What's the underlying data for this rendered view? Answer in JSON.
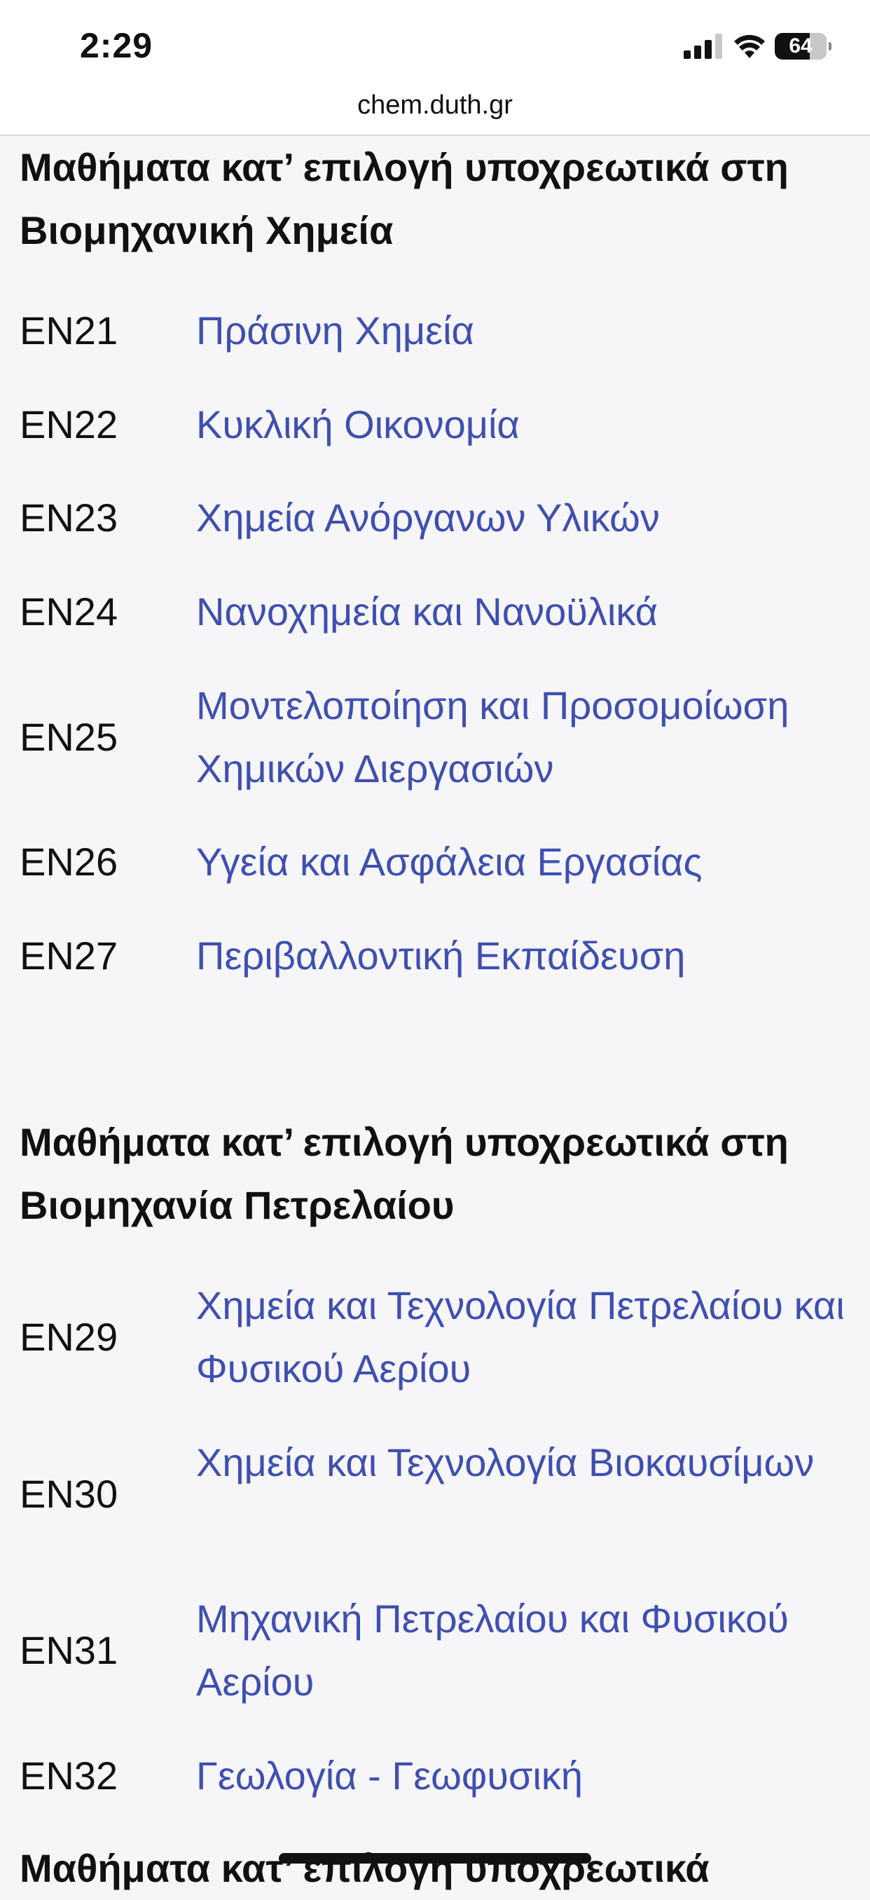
{
  "status_bar": {
    "time": "2:29",
    "battery": "64"
  },
  "browser": {
    "url": "chem.duth.gr"
  },
  "sections": [
    {
      "title": "Μαθήματα κατ’ επιλογή υποχρεωτικά στη Βιομηχανική Χημεία",
      "courses": [
        {
          "code": "EN21",
          "name": "Πράσινη Χημεία"
        },
        {
          "code": "EN22",
          "name": "Κυκλική Οικονομία"
        },
        {
          "code": "EN23",
          "name": "Χημεία Ανόργανων Υλικών"
        },
        {
          "code": "EN24",
          "name": "Νανοχημεία και Νανοϋλικά"
        },
        {
          "code": "EN25",
          "name": "Μοντελοποίηση και Προσομοίωση Χημικών Διεργασιών"
        },
        {
          "code": "EN26",
          "name": "Υγεία και Ασφάλεια Εργασίας"
        },
        {
          "code": "EN27",
          "name": "Περιβαλλοντική Εκπαίδευση"
        }
      ]
    },
    {
      "title": "Μαθήματα κατ’ επιλογή υποχρεωτικά στη Βιομηχανία Πετρελαίου",
      "courses": [
        {
          "code": "EN29",
          "name": "Χημεία και Τεχνολογία Πετρελαίου και Φυσικού Αερίου"
        },
        {
          "code": "EN30",
          "name": "Χημεία και Τεχνολογία Βιοκαυσίμων"
        },
        {
          "code": "EN31",
          "name": "Μηχανική Πετρελαίου και Φυσικού Αερίου"
        },
        {
          "code": "EN32",
          "name": "Γεωλογία - Γεωφυσική"
        }
      ]
    },
    {
      "title": "Μαθήματα κατ’ επιλογή υποχρεωτικά",
      "courses": []
    }
  ]
}
